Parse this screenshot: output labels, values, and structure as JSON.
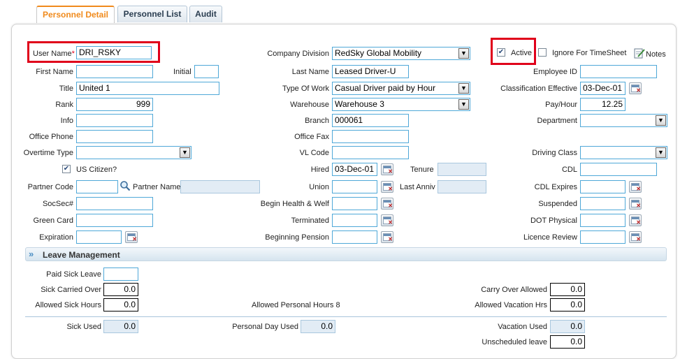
{
  "tabs": [
    {
      "label": "Personnel Detail"
    },
    {
      "label": "Personnel List"
    },
    {
      "label": "Audit"
    }
  ],
  "left": {
    "user_name": {
      "label": "User Name",
      "value": "DRI_RSKY",
      "required": "*"
    },
    "first_name": {
      "label": "First Name",
      "value": ""
    },
    "initial": {
      "label": "Initial",
      "value": ""
    },
    "title": {
      "label": "Title",
      "value": "United 1"
    },
    "rank": {
      "label": "Rank",
      "value": "999"
    },
    "info": {
      "label": "Info",
      "value": ""
    },
    "office_phone": {
      "label": "Office Phone",
      "value": ""
    },
    "overtime_type": {
      "label": "Overtime Type",
      "value": ""
    },
    "us_citizen": {
      "label": "US Citizen?",
      "checked": true
    },
    "partner_code": {
      "label": "Partner Code",
      "value": ""
    },
    "partner_name": {
      "label": "Partner Name",
      "value": ""
    },
    "socsec": {
      "label": "SocSec#",
      "value": ""
    },
    "green_card": {
      "label": "Green Card",
      "value": ""
    },
    "expiration": {
      "label": "Expiration",
      "value": ""
    }
  },
  "middle": {
    "company_division": {
      "label": "Company Division",
      "value": "RedSky Global Mobility"
    },
    "last_name": {
      "label": "Last Name",
      "value": "Leased Driver-U"
    },
    "type_of_work": {
      "label": "Type Of Work",
      "value": "Casual Driver paid by Hour"
    },
    "warehouse": {
      "label": "Warehouse",
      "value": "Warehouse 3"
    },
    "branch": {
      "label": "Branch",
      "value": "000061"
    },
    "office_fax": {
      "label": "Office Fax",
      "value": ""
    },
    "vl_code": {
      "label": "VL Code",
      "value": ""
    },
    "hired": {
      "label": "Hired",
      "value": "03-Dec-01"
    },
    "tenure": {
      "label": "Tenure",
      "value": ""
    },
    "union": {
      "label": "Union",
      "value": ""
    },
    "last_anniv": {
      "label": "Last Anniv",
      "value": ""
    },
    "begin_health": {
      "label": "Begin Health & Welf",
      "value": ""
    },
    "terminated": {
      "label": "Terminated",
      "value": ""
    },
    "beginning_pension": {
      "label": "Beginning Pension",
      "value": ""
    }
  },
  "right": {
    "active": {
      "label": "Active",
      "checked": true
    },
    "ignore_timesheet": {
      "label": "Ignore For TimeSheet",
      "checked": false
    },
    "notes": {
      "label": "Notes"
    },
    "employee_id": {
      "label": "Employee ID",
      "value": ""
    },
    "classification_effective": {
      "label": "Classification Effective",
      "value": "03-Dec-01"
    },
    "pay_hour": {
      "label": "Pay/Hour",
      "value": "12.25"
    },
    "department": {
      "label": "Department",
      "value": ""
    },
    "driving_class": {
      "label": "Driving Class",
      "value": ""
    },
    "cdl": {
      "label": "CDL",
      "value": ""
    },
    "cdl_expires": {
      "label": "CDL Expires",
      "value": ""
    },
    "suspended": {
      "label": "Suspended",
      "value": ""
    },
    "dot_physical": {
      "label": "DOT Physical",
      "value": ""
    },
    "licence_review": {
      "label": "Licence Review",
      "value": ""
    }
  },
  "leave": {
    "title": "Leave Management",
    "paid_sick_leave": {
      "label": "Paid Sick Leave",
      "value": ""
    },
    "sick_carried_over": {
      "label": "Sick Carried Over",
      "value": "0.0"
    },
    "allowed_sick_hours": {
      "label": "Allowed Sick Hours",
      "value": "0.0"
    },
    "allowed_personal_hours": {
      "label": "Allowed Personal Hours",
      "value": "8"
    },
    "carry_over_allowed": {
      "label": "Carry Over Allowed",
      "value": "0.0"
    },
    "allowed_vacation_hrs": {
      "label": "Allowed Vacation Hrs",
      "value": "0.0"
    },
    "sick_used": {
      "label": "Sick Used",
      "value": "0.0"
    },
    "personal_day_used": {
      "label": "Personal Day Used",
      "value": "0.0"
    },
    "vacation_used": {
      "label": "Vacation Used",
      "value": "0.0"
    },
    "unscheduled_leave": {
      "label": "Unscheduled leave",
      "value": "0.0"
    }
  },
  "colors": {
    "accent_tab": "#f08a1c",
    "input_border": "#4fa8d8",
    "highlight_box": "#e0001a",
    "readonly_bg": "#e2ecf5"
  },
  "icons": {
    "calendar": "calendar-icon",
    "search": "search-icon",
    "notes": "notes-icon",
    "dropdown": "chevron-down-icon",
    "section": "double-chevron-icon"
  }
}
